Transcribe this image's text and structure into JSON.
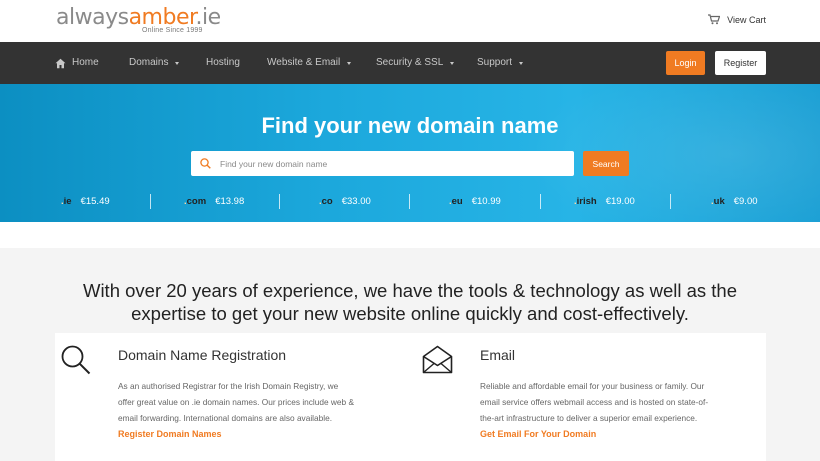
{
  "header": {
    "logo": {
      "always": "always",
      "amber": "amber",
      "ie": ".ie",
      "tagline": "Online Since 1999"
    },
    "cart_label": "View Cart"
  },
  "nav": {
    "items": [
      {
        "label": "Home",
        "icon": "home-icon"
      },
      {
        "label": "Domains",
        "dropdown": true
      },
      {
        "label": "Hosting",
        "dropdown": false
      },
      {
        "label": "Website & Email",
        "dropdown": true
      },
      {
        "label": "Security & SSL",
        "dropdown": true
      },
      {
        "label": "Support",
        "dropdown": true
      }
    ],
    "login_label": "Login",
    "register_label": "Register"
  },
  "hero": {
    "title": "Find your new domain name",
    "search_placeholder": "Find your new domain name",
    "search_button": "Search",
    "tlds": [
      {
        "ext": "ie",
        "price": "€15.49"
      },
      {
        "ext": "com",
        "price": "€13.98"
      },
      {
        "ext": "co",
        "price": "€33.00"
      },
      {
        "ext": "eu",
        "price": "€10.99"
      },
      {
        "ext": "irish",
        "price": "€19.00"
      },
      {
        "ext": "uk",
        "price": "€9.00"
      }
    ]
  },
  "main": {
    "headline_line1": "With over 20 years of experience, we have the tools & technology as well as the",
    "headline_line2": "expertise to get your new website online quickly and cost-effectively.",
    "features": [
      {
        "icon": "search-icon",
        "title": "Domain Name Registration",
        "body": [
          "As an authorised Registrar for the Irish Domain Registry, we",
          "offer great value on .ie domain names. Our prices include web &",
          "email forwarding. International domains are also available."
        ],
        "link": "Register Domain Names"
      },
      {
        "icon": "envelope-icon",
        "title": "Email",
        "body": [
          "Reliable and affordable email for your business or family. Our",
          "email service offers webmail access and is hosted on state-of-",
          "the-art infrastructure to deliver a superior email experience."
        ],
        "link": "Get Email For Your Domain"
      }
    ]
  },
  "colors": {
    "accent": "#f07b22",
    "nav_bg": "#333333",
    "hero_blue": "#1ca8dc"
  }
}
